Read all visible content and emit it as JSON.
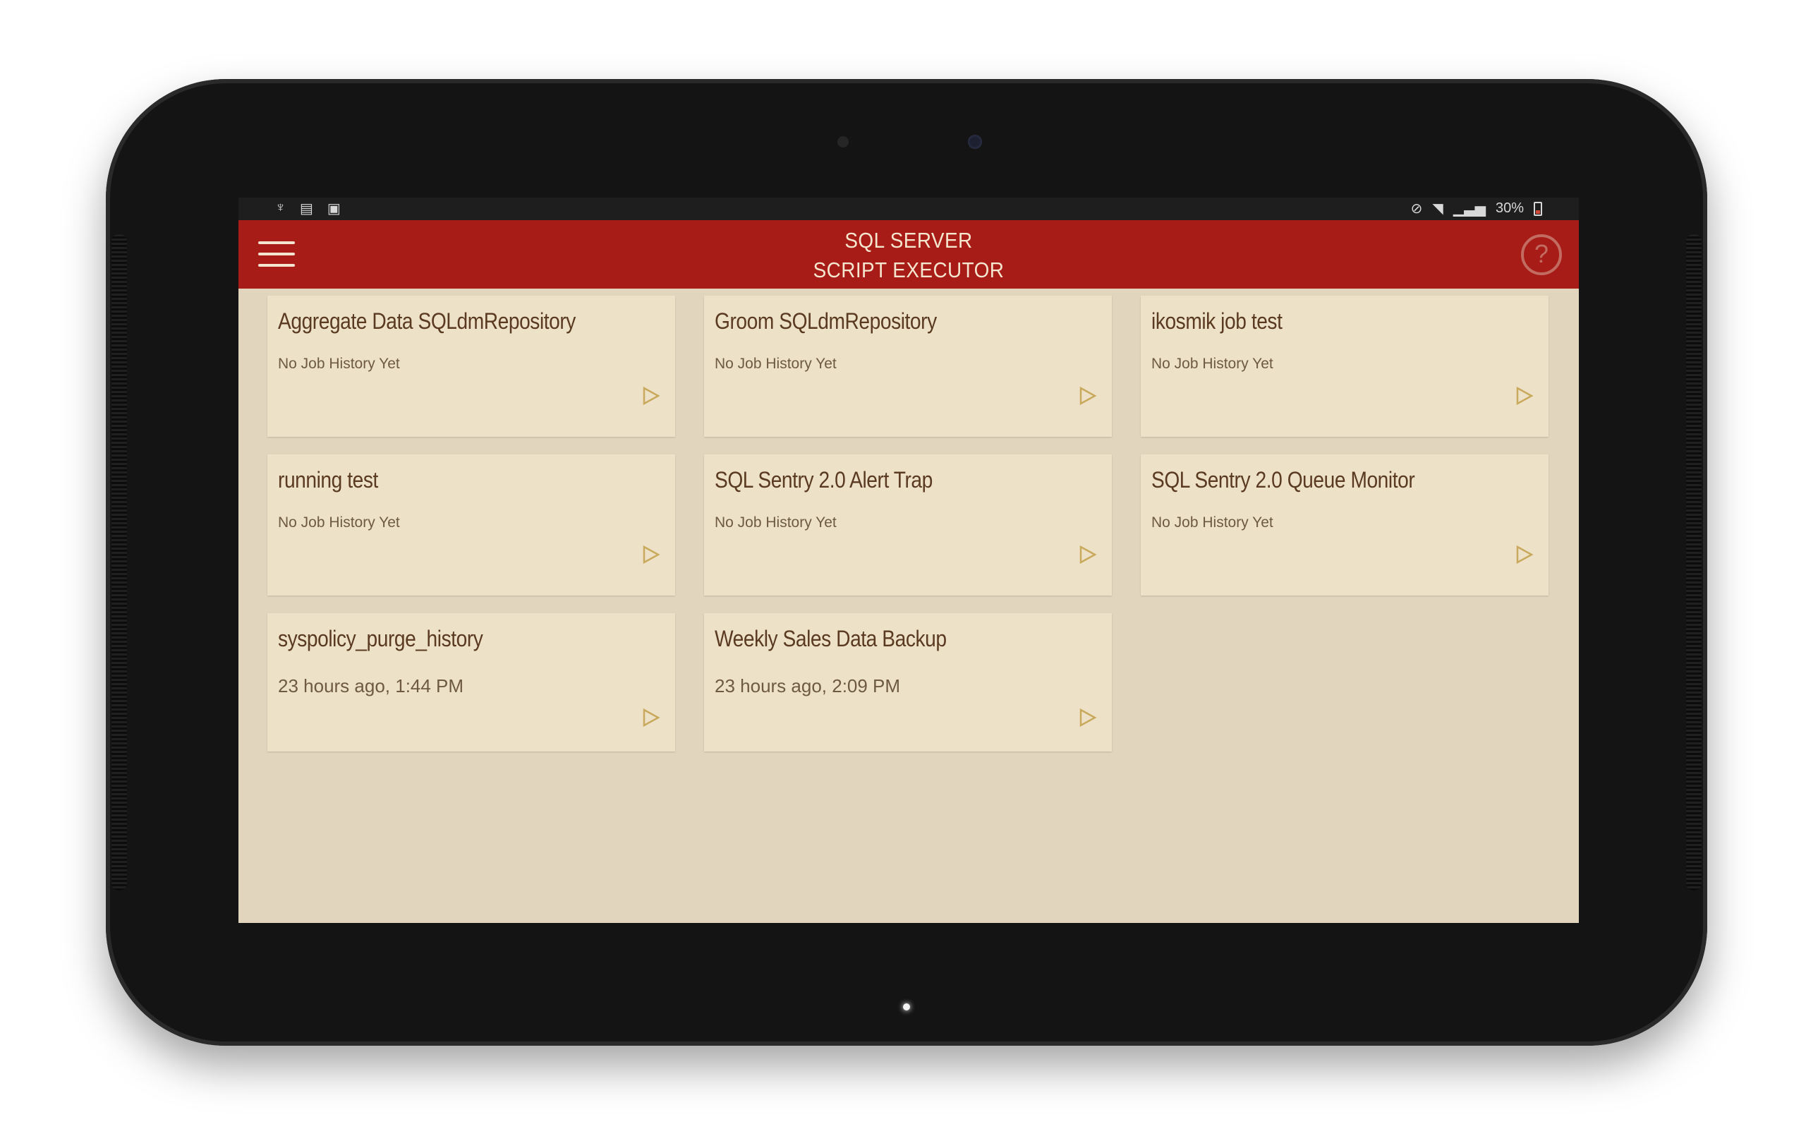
{
  "status_bar": {
    "left_icons": [
      "usb-icon",
      "sd-card-icon",
      "screenshot-icon"
    ],
    "right_icons": [
      "mute-icon",
      "wifi-icon",
      "signal-icon"
    ],
    "battery_text": "30%"
  },
  "app_bar": {
    "title_line1": "SQL SERVER",
    "title_line2": "SCRIPT EXECUTOR",
    "menu_icon": "hamburger-menu-icon",
    "help_icon": "help-icon",
    "help_glyph": "?"
  },
  "colors": {
    "app_bar": "#a81c17",
    "background": "#e2d5bd",
    "card": "#ede1c8",
    "title_text": "#5a3a21",
    "play_icon": "#c9a95c"
  },
  "jobs": [
    {
      "name": "Aggregate Data SQLdmRepository",
      "status": "No Job History Yet"
    },
    {
      "name": "Groom SQLdmRepository",
      "status": "No Job History Yet"
    },
    {
      "name": "ikosmik job test",
      "status": "No Job History Yet"
    },
    {
      "name": "running test",
      "status": "No Job History Yet"
    },
    {
      "name": "SQL Sentry 2.0 Alert Trap",
      "status": "No Job History Yet"
    },
    {
      "name": "SQL Sentry 2.0 Queue Monitor",
      "status": "No Job History Yet"
    },
    {
      "name": "syspolicy_purge_history",
      "status": "23 hours ago, 1:44 PM"
    },
    {
      "name": "Weekly Sales Data Backup",
      "status": "23 hours ago, 2:09 PM"
    }
  ]
}
